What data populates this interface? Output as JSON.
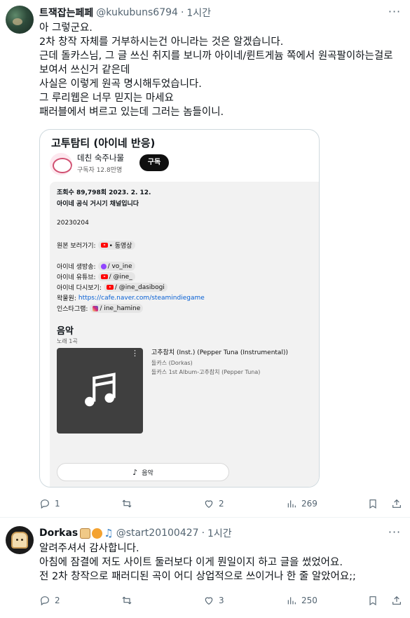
{
  "tweet1": {
    "display_name": "트잭잡는페페",
    "handle": "@kukubuns6794",
    "separator": "·",
    "time": "1시간",
    "text_lines": [
      "아 그렇군요.",
      "2차 창작 자체를 거부하시는건 아니라는 것은 알겠습니다.",
      "근데 돌카스님, 그 글 쓰신 취지를 보니까 아이네/륀트게늄 쪽에서 원곡팔이하는걸로",
      "보여서 쓰신거 같은데",
      "사실은 이렇게 원곡 명시해두었습니다.",
      "그 루리웹은 너무 믿지는 마세요",
      "패러블에서 벼르고 있는데 그러는 놈들이니."
    ],
    "card": {
      "video_title": "고투탐티 (아이네 반응)",
      "channel_name": "데친 숙주나물",
      "subscribers": "구독자 12.8만명",
      "subscribe_label": "구독",
      "meta": "조회수 89,798회  2023. 2. 12.",
      "channel_note": "아이네 공식 거시기 채널입니다",
      "date_code": "20230204",
      "original_label": "원본 보러가기:",
      "original_chip": "• 동영상",
      "stream_label": "아이네 생방송:",
      "stream_chip": "/ vo_ine",
      "youtube_label": "아이네 유튜브:",
      "youtube_chip": "/ @ine_",
      "replay_label": "아이네 다시보기:",
      "replay_chip": "/ @ine_dasibogi",
      "cafe_label": "왁물원:",
      "cafe_link": "https://cafe.naver.com/steamindiegame",
      "insta_label": "인스타그램:",
      "insta_chip": "/ ine_hamine",
      "music_heading": "음악",
      "music_count": "노래 1곡",
      "song_title": "고추참치 (Inst.) (Pepper Tuna (Instrumental))",
      "song_artist": "돌카스 (Dorkas)",
      "song_album": "돌카스 1st Album-고추참치 (Pepper Tuna)",
      "music_button": "음악"
    },
    "actions": {
      "replies": "1",
      "retweets": "",
      "likes": "2",
      "views": "269"
    }
  },
  "tweet2": {
    "display_name": "Dorkas",
    "handle": "@start20100427",
    "separator": "·",
    "time": "1시간",
    "text_lines": [
      "알려주셔서 감사합니다.",
      "아침에 잠결에 저도 사이트 둘러보다 이게 뭔일이지 하고 글을 썼었어요.",
      "전 2차 창작으로 패러디된 곡이 어디 상업적으로 쓰이거나 한 줄 알았어요;;"
    ],
    "actions": {
      "replies": "2",
      "retweets": "",
      "likes": "3",
      "views": "250"
    }
  },
  "icons": {
    "reply": "reply-icon",
    "retweet": "retweet-icon",
    "like": "heart-icon",
    "views": "views-icon",
    "bookmark": "bookmark-icon",
    "share": "share-icon",
    "more": "more-icon",
    "music_note": "music-note-icon"
  },
  "colors": {
    "text": "#0f1419",
    "muted": "#536471",
    "link": "#065fd4",
    "youtube_red": "#ff0000"
  }
}
